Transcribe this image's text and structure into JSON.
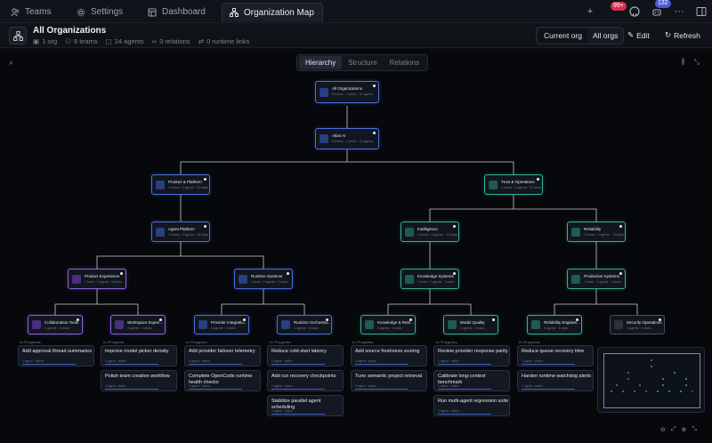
{
  "tabs": [
    {
      "label": "Teams",
      "icon": "users-icon"
    },
    {
      "label": "Settings",
      "icon": "gear-icon"
    },
    {
      "label": "Dashboard",
      "icon": "dashboard-icon"
    },
    {
      "label": "Organization Map",
      "icon": "org-map-icon",
      "active": true
    }
  ],
  "titlebar": {
    "notifications_badge": "99+",
    "alerts_badge": "132"
  },
  "header": {
    "title": "All Organizations",
    "stats": {
      "orgs": "1 org",
      "teams": "8 teams",
      "agents": "24 agents",
      "relations": "3 relations",
      "runtime_links": "0 runtime links"
    },
    "scope_current": "Current org",
    "scope_all": "All orgs",
    "edit_label": "Edit",
    "refresh_label": "Refresh"
  },
  "view_modes": [
    "Hierarchy",
    "Structure",
    "Relations"
  ],
  "nodes": {
    "all_orgs": {
      "title": "All Organizations",
      "sub": "8 teams · 1 active · 24 agents"
    },
    "atlas": {
      "title": "Atlas AI",
      "sub": "8 teams · 1 active · 24 agents"
    },
    "product": {
      "title": "Product & Platform",
      "sub": "4 teams · 6 agents · 33 tasks"
    },
    "trust": {
      "title": "Trust & Operations",
      "sub": "4 teams · 6 agents · 30 tasks"
    },
    "agent_platform": {
      "title": "Agent Platform",
      "sub": "2 teams · 3 agents · 16 tasks"
    },
    "intelligence": {
      "title": "Intelligence",
      "sub": "2 teams · 3 agents · 14 tasks"
    },
    "reliability": {
      "title": "Reliability",
      "sub": "2 teams · 3 agents · 13 tasks"
    },
    "product_exp": {
      "title": "Product Experience",
      "sub": "1 team · 2 agents · 8 tasks"
    },
    "runtime": {
      "title": "Runtime Systems",
      "sub": "1 team · 2 agents · 8 tasks"
    },
    "knowledge": {
      "title": "Knowledge Systems",
      "sub": "1 team · 2 agents · 7 tasks"
    },
    "production": {
      "title": "Production Systems",
      "sub": "1 team · 2 agents · 7 tasks"
    },
    "collab": {
      "title": "Collaboration Tools",
      "sub": "4 agents · 4 tasks"
    },
    "workspace": {
      "title": "Workspace Experi...",
      "sub": "4 agents · 4 tasks"
    },
    "provider": {
      "title": "Provider Integratio...",
      "sub": "4 agents · 4 tasks"
    },
    "runtime_orch": {
      "title": "Runtime Orchestra...",
      "sub": "4 agents · 4 tasks"
    },
    "knowledge_ret": {
      "title": "Knowledge & Retri...",
      "sub": "4 agents · 4 tasks"
    },
    "model_quality": {
      "title": "Model Quality",
      "sub": "4 agents · 4 tasks"
    },
    "reliability_eng": {
      "title": "Reliability Enginee...",
      "sub": "4 agents · 4 tasks"
    },
    "security": {
      "title": "Security Operations",
      "sub": "4 agents · 4 tasks"
    }
  },
  "task_header": "In Progress",
  "task_meta": "1 agent · active",
  "tasks": [
    [
      "Add approval thread summaries"
    ],
    [
      "Improve model picker density",
      "Polish team creation workflow"
    ],
    [
      "Add provider failover telemetry",
      "Complete OpenCode runtime health checks"
    ],
    [
      "Reduce cold-start latency",
      "Add run recovery checkpoints",
      "Stabilize parallel agent scheduling"
    ],
    [
      "Add source freshness scoring",
      "Tune semantic project retrieval"
    ],
    [
      "Review provider response parity",
      "Calibrate long-context benchmark",
      "Run multi-agent regression suite"
    ],
    [
      "Reduce queue recovery time",
      "Harden runtime watchdog alerts"
    ]
  ],
  "colors": {
    "blue": "#4a6fe0",
    "teal": "#2db39a",
    "purple": "#8a62e0",
    "gray": "#4a505c",
    "accent": "#4b5bd6",
    "badge_red": "#d6334a"
  }
}
